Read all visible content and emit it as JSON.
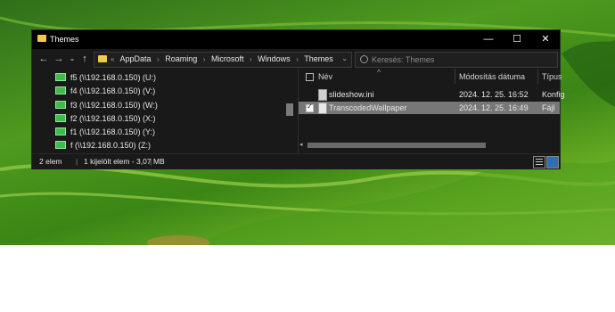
{
  "window": {
    "title": "Themes",
    "minimize_glyph": "—",
    "maximize_glyph": "☐",
    "close_glyph": "✕"
  },
  "nav": {
    "back_glyph": "←",
    "forward_glyph": "→",
    "recent_glyph": "⌄",
    "up_glyph": "↑"
  },
  "address": {
    "overflow": "«",
    "crumbs": [
      "AppData",
      "Roaming",
      "Microsoft",
      "Windows",
      "Themes"
    ],
    "separator": "›",
    "dropdown_glyph": "⌄",
    "refresh_glyph": "↻"
  },
  "search": {
    "placeholder": "Keresés: Themes"
  },
  "nav_pane": {
    "drives": [
      "f5 (\\\\192.168.0.150) (U:)",
      "f4 (\\\\192.168.0.150) (V:)",
      "f3 (\\\\192.168.0.150) (W:)",
      "f2 (\\\\192.168.0.150) (X:)",
      "f1 (\\\\192.168.0.150) (Y:)",
      "f (\\\\192.168.0.150) (Z:)"
    ],
    "icon": "network-drive-icon"
  },
  "columns": {
    "name": "Név",
    "modified": "Módosítás dátuma",
    "type": "Típus",
    "sort_glyph": "^"
  },
  "files": [
    {
      "name": "slideshow.ini",
      "modified": "2024. 12. 25. 16:52",
      "type": "Konfig",
      "selected": false,
      "icon": "config-file-icon"
    },
    {
      "name": "TranscodedWallpaper",
      "modified": "2024. 12. 25. 16:49",
      "type": "Fájl",
      "selected": true,
      "icon": "file-icon"
    }
  ],
  "status": {
    "count": "2 elem",
    "selection": "1 kijelölt elem - 3,07 MB",
    "separator": "|"
  },
  "colors": {
    "explorer_bg": "#191919",
    "titlebar_bg": "#000000",
    "selection_bg": "#777777",
    "folder_yellow": "#f2c94c",
    "drive_green": "#3dbb4b"
  }
}
